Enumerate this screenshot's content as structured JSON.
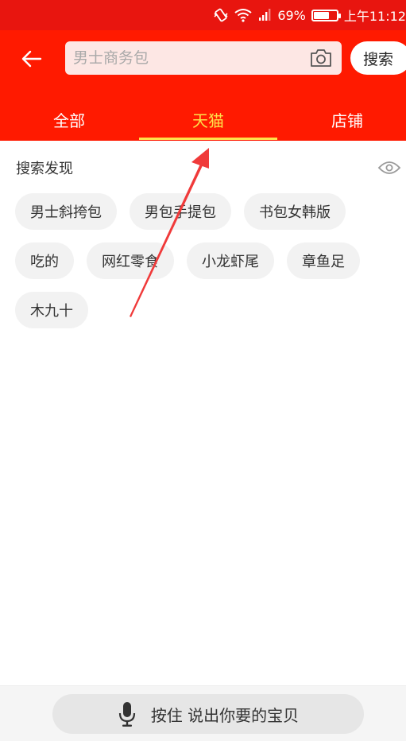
{
  "status_bar": {
    "battery_percent_text": "69%",
    "battery_level": 0.69,
    "time": "上午11:12",
    "icons": [
      "vibrate-icon",
      "wifi-icon",
      "signal-icon",
      "battery-icon"
    ]
  },
  "header": {
    "back_icon": "back-arrow-icon",
    "search": {
      "placeholder": "男士商务包",
      "camera_icon": "camera-icon"
    },
    "search_button_label": "搜索",
    "tabs": [
      {
        "label": "全部",
        "active": false
      },
      {
        "label": "天猫",
        "active": true
      },
      {
        "label": "店铺",
        "active": false
      }
    ]
  },
  "discover": {
    "title": "搜索发现",
    "visibility_icon": "eye-icon",
    "chips": [
      "男士斜挎包",
      "男包手提包",
      "书包女韩版",
      "吃的",
      "网红零食",
      "小龙虾尾",
      "章鱼足",
      "木九十"
    ]
  },
  "voice": {
    "icon": "microphone-icon",
    "label": "按住 说出你要的宝贝"
  },
  "colors": {
    "header_red": "#ff1a00",
    "status_red": "#e8150f",
    "active_tab": "#ffe14a",
    "chip_bg": "#f2f2f2",
    "annotation_arrow": "#f03a3a"
  }
}
